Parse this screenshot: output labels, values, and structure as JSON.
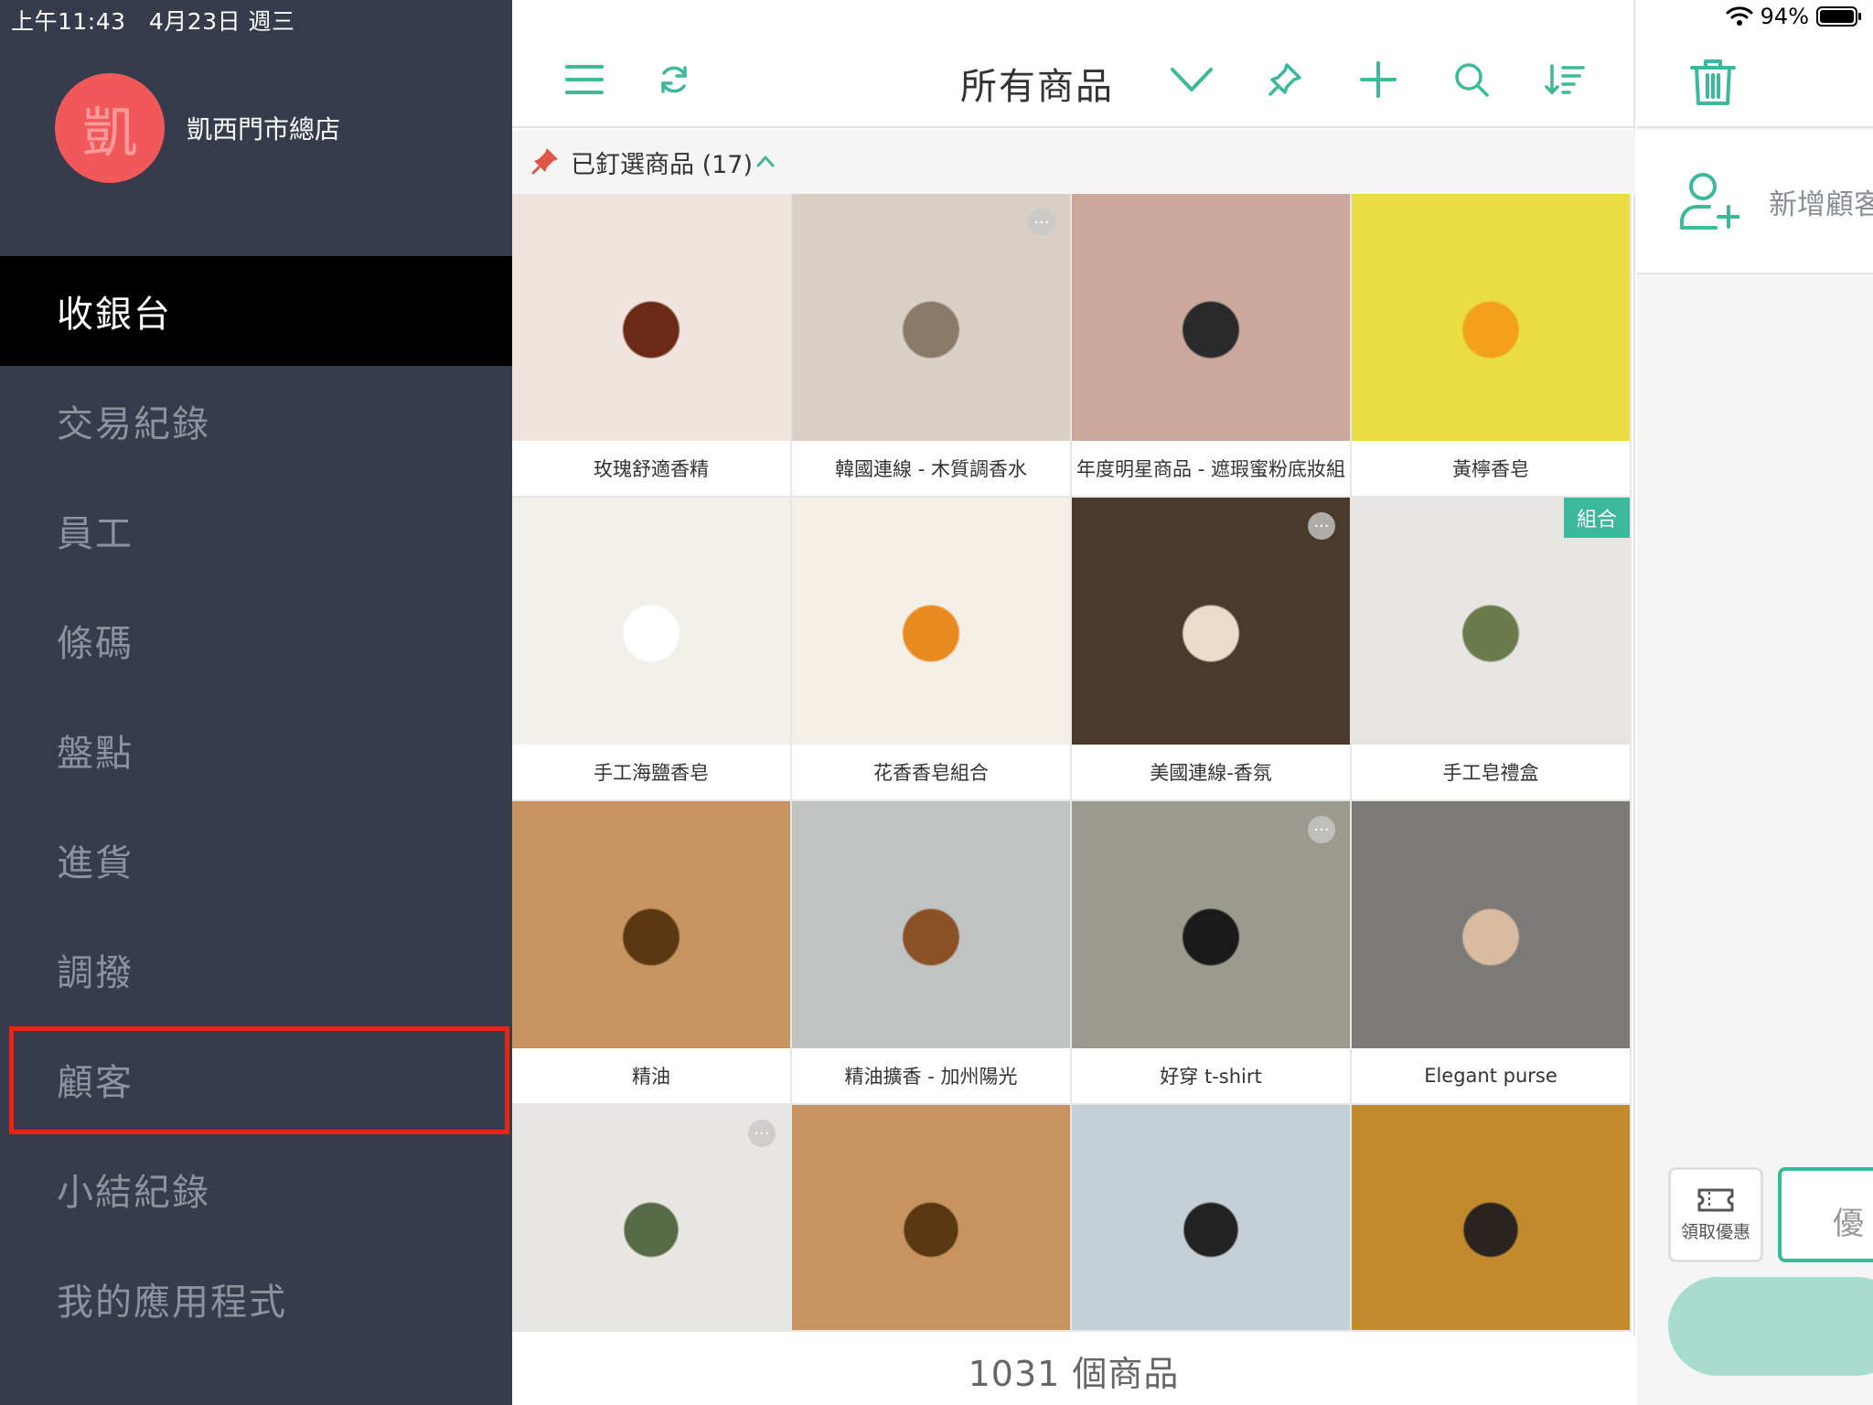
{
  "status": {
    "time": "上午11:43",
    "date": "4月23日 週三",
    "battery": "94%"
  },
  "store": {
    "avatar_char": "凱",
    "name": "凱西門市總店"
  },
  "nav": {
    "items": [
      {
        "label": "收銀台",
        "active": true
      },
      {
        "label": "交易紀錄"
      },
      {
        "label": "員工"
      },
      {
        "label": "條碼"
      },
      {
        "label": "盤點"
      },
      {
        "label": "進貨"
      },
      {
        "label": "調撥"
      },
      {
        "label": "顧客",
        "highlighted": true
      },
      {
        "label": "小結紀錄"
      },
      {
        "label": "我的應用程式"
      }
    ]
  },
  "toolbar": {
    "title": "所有商品",
    "icons": [
      "menu-icon",
      "refresh-icon",
      "chevron-down-icon",
      "pin-icon",
      "plus-icon",
      "search-icon",
      "sort-icon"
    ]
  },
  "pinned": {
    "label": "已釘選商品 (17)"
  },
  "products": [
    {
      "name": "玫瑰舒適香精",
      "bg": "#efe4de",
      "accent": "#6a2a15"
    },
    {
      "name": "韓國連線 - 木質調香水",
      "bg": "#d8cfc5",
      "accent": "#8a7a6a",
      "more": "···"
    },
    {
      "name": "年度明星商品 - 遮瑕蜜粉底妝組",
      "bg": "#caa99c",
      "accent": "#2a2a2a"
    },
    {
      "name": "黃檸香皂",
      "bg": "#e9dc45",
      "accent": "#f3a01c"
    },
    {
      "name": "手工海鹽香皂",
      "bg": "#f1efea",
      "accent": "#ffffff"
    },
    {
      "name": "花香香皂組合",
      "bg": "#f3eee6",
      "accent": "#e98a1e"
    },
    {
      "name": "美國連線-香氛",
      "bg": "#4a3a2c",
      "accent": "#e9dccb",
      "more": "···"
    },
    {
      "name": "手工皂禮盒",
      "bg": "#e7e5e2",
      "accent": "#6d7a4e",
      "badge": "組合"
    },
    {
      "name": "精油",
      "bg": "#c79461",
      "accent": "#5a3812"
    },
    {
      "name": "精油擴香 - 加州陽光",
      "bg": "#bfc3c2",
      "accent": "#8a5026"
    },
    {
      "name": "好穿 t-shirt",
      "bg": "#9a9a8e",
      "accent": "#1a1a1a",
      "more": "···"
    },
    {
      "name": "Elegant purse",
      "bg": "#7c7a77",
      "accent": "#d8bba0"
    },
    {
      "name": "",
      "bg": "#e8e6e2",
      "accent": "#566a45",
      "more": "···"
    },
    {
      "name": "",
      "bg": "#c79461",
      "accent": "#5a3812"
    },
    {
      "name": "",
      "bg": "#c6ced6",
      "accent": "#222222"
    },
    {
      "name": "",
      "bg": "#c18b2d",
      "accent": "#2a2420"
    }
  ],
  "footer": {
    "count_label": "1031 個商品"
  },
  "right": {
    "add_customer": "新增顧客",
    "coupon": "領取優惠",
    "discount": "優"
  },
  "colors": {
    "accent": "#3bb99a",
    "sidebar": "#363c4b",
    "highlight": "#e8250f"
  }
}
